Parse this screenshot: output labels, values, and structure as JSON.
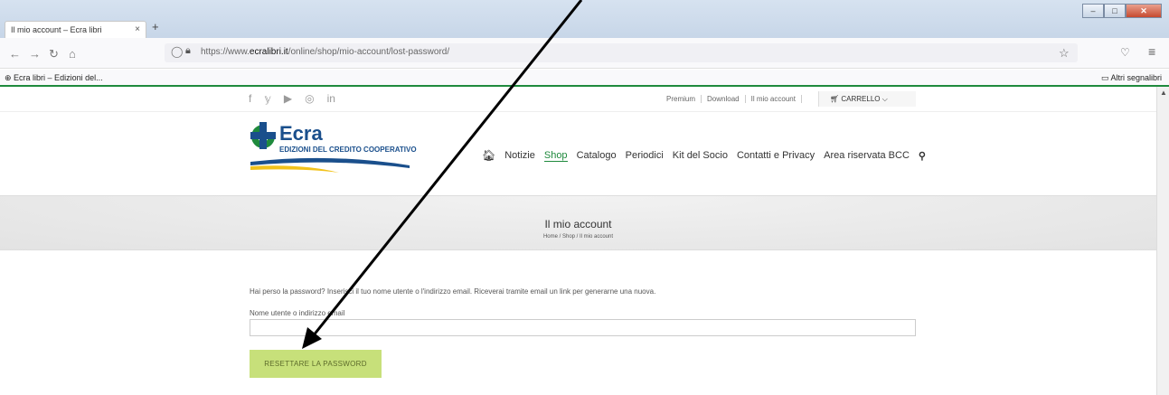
{
  "browser": {
    "tab_title": "Il mio account – Ecra libri",
    "tab_close": "×",
    "new_tab": "+",
    "url_prefix": "https://www.",
    "url_domain": "ecralibri.it",
    "url_path": "/online/shop/mio-account/lost-password/",
    "bookmark_left": "Ecra libri – Edizioni del...",
    "bookmark_right": "Altri segnalibri",
    "icons": [
      "back-icon",
      "forward-icon",
      "reload-icon",
      "home-icon",
      "shield-icon",
      "lock-icon",
      "star-icon",
      "pocket-icon",
      "menu-icon"
    ]
  },
  "topbar": {
    "social": [
      "f",
      "𝕪",
      "▶",
      "◎",
      "in"
    ],
    "links": [
      "Premium",
      "Download",
      "Il mio account"
    ],
    "cart": "CARRELLO"
  },
  "logo": {
    "name": "Ecra",
    "tagline": "EDIZIONI DEL CREDITO COOPERATIVO",
    "colors": {
      "blue": "#1a4f8c",
      "green": "#1f8a3d",
      "yellow": "#f2c21b"
    }
  },
  "nav": {
    "items": [
      "Notizie",
      "Shop",
      "Catalogo",
      "Periodici",
      "Kit del Socio",
      "Contatti e Privacy",
      "Area riservata BCC"
    ],
    "active": "Shop"
  },
  "hero": {
    "title": "Il mio account",
    "breadcrumb": "Home / Shop / Il mio account"
  },
  "form": {
    "intro": "Hai perso la password? Inserisci il tuo nome utente o l'indirizzo email. Riceverai tramite email un link per generarne una nuova.",
    "field_label": "Nome utente o indirizzo email",
    "field_value": "",
    "submit": "RESETTARE LA PASSWORD",
    "button_color": "#c7e07a"
  }
}
